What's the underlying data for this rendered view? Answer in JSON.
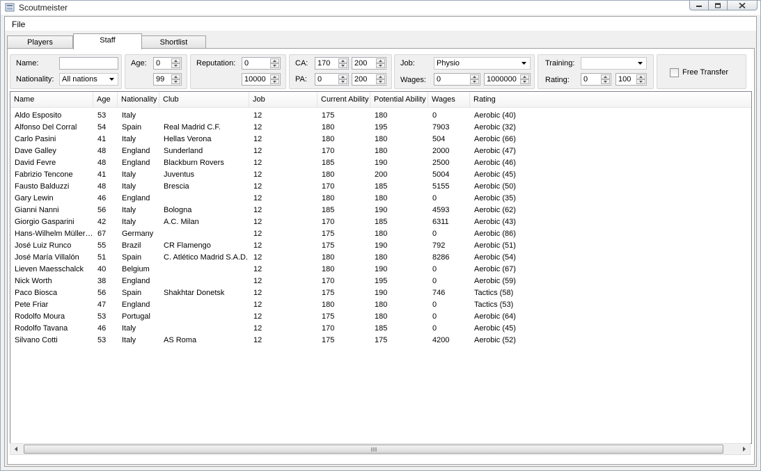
{
  "window": {
    "title": "Scoutmeister"
  },
  "menu": {
    "file": "File"
  },
  "tabs": [
    {
      "label": "Players"
    },
    {
      "label": "Staff"
    },
    {
      "label": "Shortlist"
    }
  ],
  "filters": {
    "name_label": "Name:",
    "name_value": "",
    "nationality_label": "Nationality:",
    "nationality_value": "All nations",
    "age_label": "Age:",
    "age_min": "0",
    "age_max": "99",
    "reputation_label": "Reputation:",
    "reputation_min": "0",
    "reputation_max": "10000",
    "ca_label": "CA:",
    "ca_min": "170",
    "ca_max": "200",
    "pa_label": "PA:",
    "pa_min": "0",
    "pa_max": "200",
    "job_label": "Job:",
    "job_value": "Physio",
    "wages_label": "Wages:",
    "wages_min": "0",
    "wages_max": "1000000",
    "training_label": "Training:",
    "training_value": "",
    "rating_label": "Rating:",
    "rating_min": "0",
    "rating_max": "100",
    "free_transfer_label": "Free Transfer",
    "free_transfer_checked": false
  },
  "table": {
    "columns": [
      "Name",
      "Age",
      "Nationality",
      "Club",
      "Job",
      "Current Ability",
      "Potential Ability",
      "Wages",
      "Rating"
    ],
    "rows": [
      [
        "Aldo Esposito",
        "53",
        "Italy",
        "",
        "12",
        "175",
        "180",
        "0",
        "Aerobic (40)"
      ],
      [
        "Alfonso Del Corral",
        "54",
        "Spain",
        "Real Madrid C.F.",
        "12",
        "180",
        "195",
        "7903",
        "Aerobic (32)"
      ],
      [
        "Carlo Pasini",
        "41",
        "Italy",
        "Hellas Verona",
        "12",
        "180",
        "180",
        "504",
        "Aerobic (66)"
      ],
      [
        "Dave Galley",
        "48",
        "England",
        "Sunderland",
        "12",
        "170",
        "180",
        "2000",
        "Aerobic (47)"
      ],
      [
        "David Fevre",
        "48",
        "England",
        "Blackburn Rovers",
        "12",
        "185",
        "190",
        "2500",
        "Aerobic (46)"
      ],
      [
        "Fabrizio Tencone",
        "41",
        "Italy",
        "Juventus",
        "12",
        "180",
        "200",
        "5004",
        "Aerobic (45)"
      ],
      [
        "Fausto Balduzzi",
        "48",
        "Italy",
        "Brescia",
        "12",
        "170",
        "185",
        "5155",
        "Aerobic (50)"
      ],
      [
        "Gary Lewin",
        "46",
        "England",
        "",
        "12",
        "180",
        "180",
        "0",
        "Aerobic (35)"
      ],
      [
        "Gianni Nanni",
        "56",
        "Italy",
        "Bologna",
        "12",
        "185",
        "190",
        "4593",
        "Aerobic (62)"
      ],
      [
        "Giorgio Gasparini",
        "42",
        "Italy",
        "A.C. Milan",
        "12",
        "170",
        "185",
        "6311",
        "Aerobic (43)"
      ],
      [
        "Hans-Wilhelm Müller-...",
        "67",
        "Germany",
        "",
        "12",
        "175",
        "180",
        "0",
        "Aerobic (86)"
      ],
      [
        "José Luiz Runco",
        "55",
        "Brazil",
        "CR Flamengo",
        "12",
        "175",
        "190",
        "792",
        "Aerobic (51)"
      ],
      [
        "José María Villalón",
        "51",
        "Spain",
        "C. Atlético Madrid S.A.D.",
        "12",
        "180",
        "180",
        "8286",
        "Aerobic (54)"
      ],
      [
        "Lieven Maesschalck",
        "40",
        "Belgium",
        "",
        "12",
        "180",
        "190",
        "0",
        "Aerobic (67)"
      ],
      [
        "Nick Worth",
        "38",
        "England",
        "",
        "12",
        "170",
        "195",
        "0",
        "Aerobic (59)"
      ],
      [
        "Paco Biosca",
        "56",
        "Spain",
        "Shakhtar Donetsk",
        "12",
        "175",
        "190",
        "746",
        "Tactics (58)"
      ],
      [
        "Pete Friar",
        "47",
        "England",
        "",
        "12",
        "180",
        "180",
        "0",
        "Tactics (53)"
      ],
      [
        "Rodolfo Moura",
        "53",
        "Portugal",
        "",
        "12",
        "175",
        "180",
        "0",
        "Aerobic (64)"
      ],
      [
        "Rodolfo Tavana",
        "46",
        "Italy",
        "",
        "12",
        "170",
        "185",
        "0",
        "Aerobic (45)"
      ],
      [
        "Silvano Cotti",
        "53",
        "Italy",
        "AS Roma",
        "12",
        "175",
        "175",
        "4200",
        "Aerobic (52)"
      ]
    ]
  }
}
